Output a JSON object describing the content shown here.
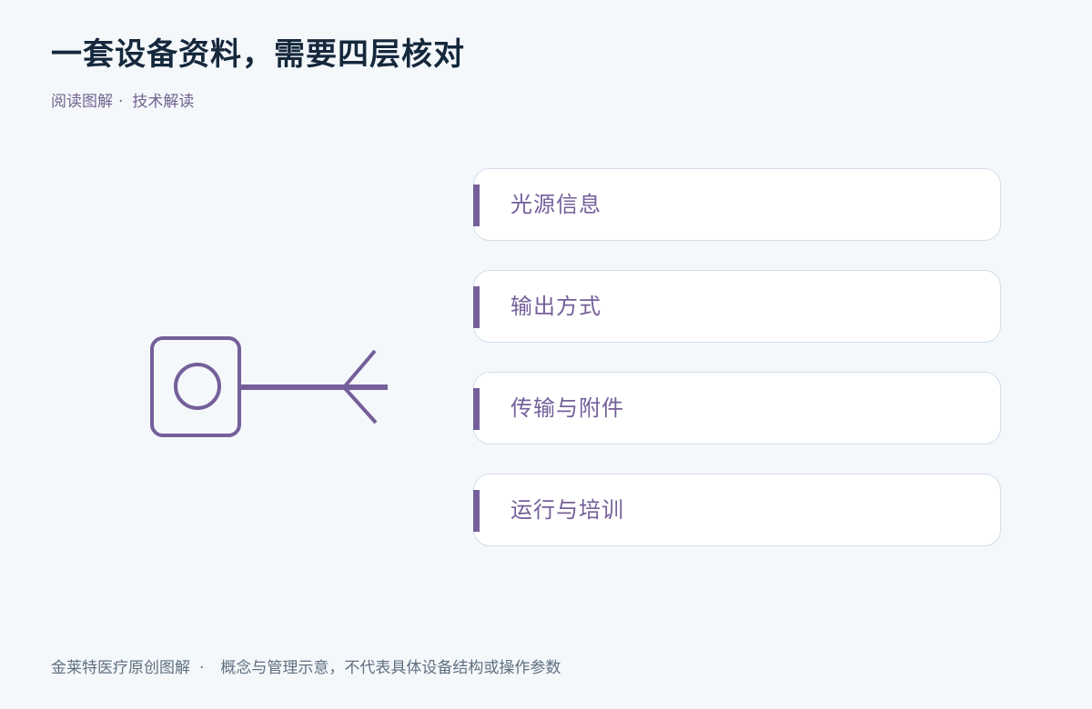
{
  "title": "一套设备资料，需要四层核对",
  "subtitle": {
    "left": "阅读图解",
    "separator": "·",
    "right": "技术解读"
  },
  "cards": [
    {
      "label": "光源信息"
    },
    {
      "label": "输出方式"
    },
    {
      "label": "传输与附件"
    },
    {
      "label": "运行与培训"
    }
  ],
  "footer": {
    "left": "金莱特医疗原创图解",
    "separator": "·",
    "right": "概念与管理示意，不代表具体设备结构或操作参数"
  },
  "colors": {
    "accent": "#745f9a",
    "title": "#15283c",
    "card_border": "#d3dde8",
    "background": "#f5f8fb"
  },
  "icons": {
    "illustration": "light-source-device-with-branching-output-icon"
  }
}
